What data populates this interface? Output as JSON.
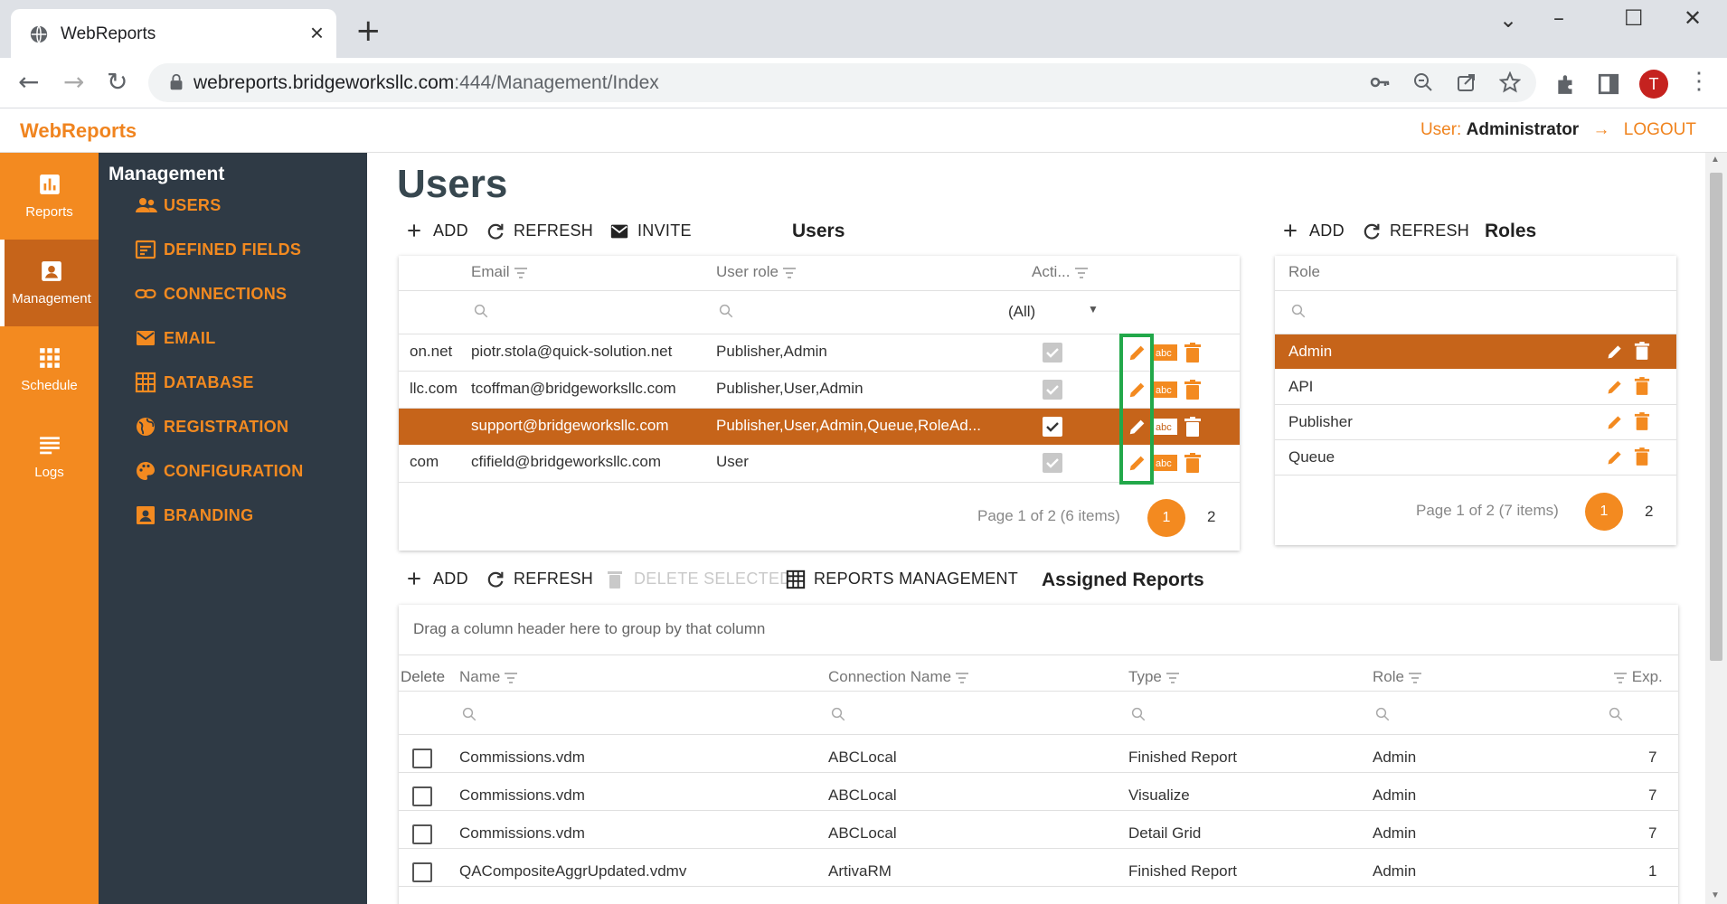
{
  "browser": {
    "tab_title": "WebReports",
    "url_host": "webreports.bridgeworksllc.com",
    "url_path": ":444/Management/Index",
    "profile_initial": "T"
  },
  "app": {
    "brand": "WebReports",
    "user_label": "User:",
    "user_name": "Administrator",
    "logout": "LOGOUT",
    "accent": "#f38a20"
  },
  "rail": [
    {
      "label": "Reports",
      "icon": "chart-icon"
    },
    {
      "label": "Management",
      "icon": "badge-icon"
    },
    {
      "label": "Schedule",
      "icon": "grid-icon"
    },
    {
      "label": "Logs",
      "icon": "list-icon"
    }
  ],
  "sidebar": {
    "title": "Management",
    "items": [
      {
        "label": "USERS",
        "icon": "people-icon"
      },
      {
        "label": "DEFINED FIELDS",
        "icon": "fields-icon"
      },
      {
        "label": "CONNECTIONS",
        "icon": "link-icon"
      },
      {
        "label": "EMAIL",
        "icon": "mail-icon"
      },
      {
        "label": "DATABASE",
        "icon": "table-icon"
      },
      {
        "label": "REGISTRATION",
        "icon": "globe-icon"
      },
      {
        "label": "CONFIGURATION",
        "icon": "palette-icon"
      },
      {
        "label": "BRANDING",
        "icon": "portrait-icon"
      }
    ]
  },
  "page": {
    "title": "Users"
  },
  "users": {
    "toolbar": {
      "add": "ADD",
      "refresh": "REFRESH",
      "invite": "INVITE"
    },
    "title": "Users",
    "headers": {
      "email": "Email",
      "role": "User role",
      "active": "Acti..."
    },
    "filter_all": "(All)",
    "rows": [
      {
        "login": "on.net",
        "email": "piotr.stola@quick-solution.net",
        "role": "Publisher,Admin",
        "active": true,
        "selected": false
      },
      {
        "login": "llc.com",
        "email": "tcoffman@bridgeworksllc.com",
        "role": "Publisher,User,Admin",
        "active": true,
        "selected": false
      },
      {
        "login": "",
        "email": "support@bridgeworksllc.com",
        "role": "Publisher,User,Admin,Queue,RoleAd...",
        "active": true,
        "selected": true
      },
      {
        "login": "com",
        "email": "cfifield@bridgeworksllc.com",
        "role": "User",
        "active": true,
        "selected": false
      }
    ],
    "pager_text": "Page 1 of 2 (6 items)",
    "page_current": "1",
    "page_next": "2"
  },
  "roles": {
    "toolbar": {
      "add": "ADD",
      "refresh": "REFRESH"
    },
    "title": "Roles",
    "header": "Role",
    "rows": [
      {
        "name": "Admin",
        "selected": true
      },
      {
        "name": "API",
        "selected": false
      },
      {
        "name": "Publisher",
        "selected": false
      },
      {
        "name": "Queue",
        "selected": false
      }
    ],
    "pager_text": "Page 1 of 2 (7 items)",
    "page_current": "1",
    "page_next": "2"
  },
  "assigned": {
    "toolbar": {
      "add": "ADD",
      "refresh": "REFRESH",
      "delete_selected": "DELETE SELECTED",
      "reports_management": "REPORTS MANAGEMENT"
    },
    "title": "Assigned Reports",
    "group_hint": "Drag a column header here to group by that column",
    "headers": {
      "delete": "Delete",
      "name": "Name",
      "connection": "Connection Name",
      "type": "Type",
      "role": "Role",
      "exp": "Exp."
    },
    "rows": [
      {
        "name": "Commissions.vdm",
        "connection": "ABCLocal",
        "type": "Finished Report",
        "role": "Admin",
        "exp": "7"
      },
      {
        "name": "Commissions.vdm",
        "connection": "ABCLocal",
        "type": "Visualize",
        "role": "Admin",
        "exp": "7"
      },
      {
        "name": "Commissions.vdm",
        "connection": "ABCLocal",
        "type": "Detail Grid",
        "role": "Admin",
        "exp": "7"
      },
      {
        "name": "QACompositeAggrUpdated.vdmv",
        "connection": "ArtivaRM",
        "type": "Finished Report",
        "role": "Admin",
        "exp": "1"
      }
    ]
  }
}
